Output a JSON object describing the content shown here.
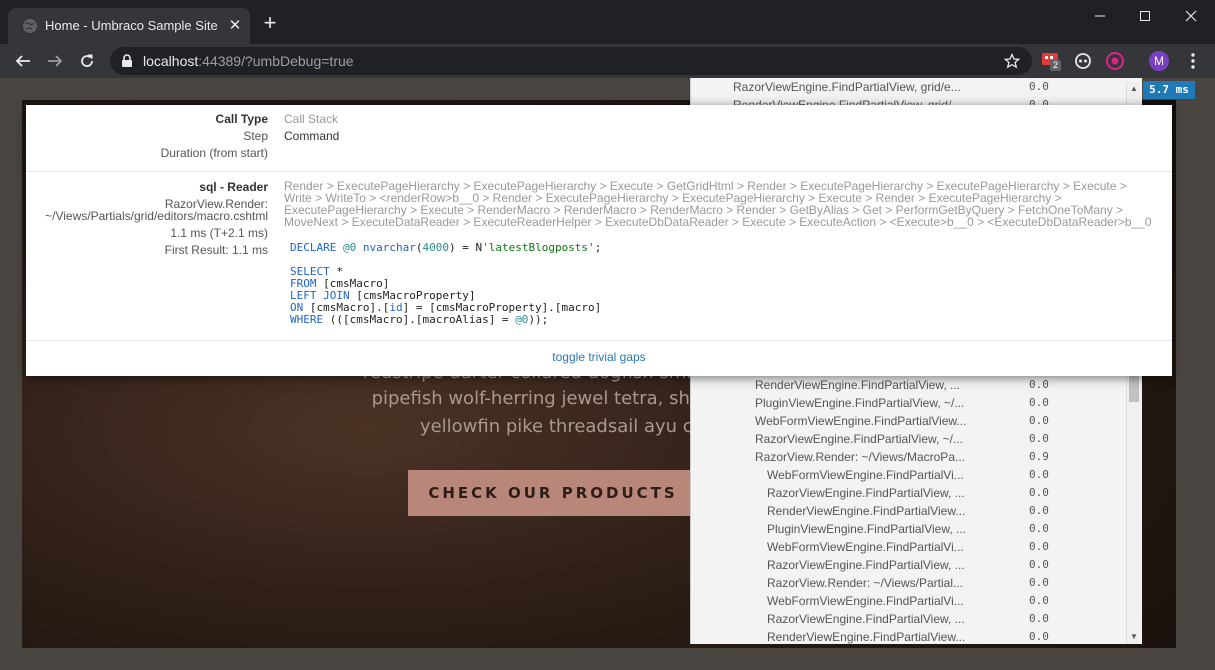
{
  "browser": {
    "tab_title": "Home - Umbraco Sample Site",
    "url_host": "localhost",
    "url_rest": ":44389/?umbDebug=true",
    "extension_badge": "2",
    "profile_initial": "M"
  },
  "hero": {
    "line1": "redstripe darter collared dogfish smalleye squaretail",
    "line2": "pipefish wolf-herring jewel tetra, shiner; gibberfish",
    "line3": "yellowfin pike threadsail ayu cutlassfish",
    "cta_label": "CHECK OUR PRODUCTS"
  },
  "profiler": {
    "total_badge": "5.7 ms",
    "rows": [
      {
        "name": "RazorViewEngine.FindPartialView, grid/e...",
        "dur": "0.0",
        "indent": 0
      },
      {
        "name": "RenderViewEngine.FindPartialView, grid/...",
        "dur": "0.0",
        "indent": 0
      },
      {
        "name": "RenderViewEngine.FindPartialView, ...",
        "dur": "0.0",
        "indent": 1
      },
      {
        "name": "PluginViewEngine.FindPartialView, ~/...",
        "dur": "0.0",
        "indent": 1
      },
      {
        "name": "WebFormViewEngine.FindPartialView...",
        "dur": "0.0",
        "indent": 1
      },
      {
        "name": "RazorViewEngine.FindPartialView, ~/...",
        "dur": "0.0",
        "indent": 1
      },
      {
        "name": "RazorView.Render: ~/Views/MacroPa...",
        "dur": "0.9",
        "indent": 1
      },
      {
        "name": "WebFormViewEngine.FindPartialVi...",
        "dur": "0.0",
        "indent": 2
      },
      {
        "name": "RazorViewEngine.FindPartialView, ...",
        "dur": "0.0",
        "indent": 2
      },
      {
        "name": "RenderViewEngine.FindPartialView...",
        "dur": "0.0",
        "indent": 2
      },
      {
        "name": "PluginViewEngine.FindPartialView, ...",
        "dur": "0.0",
        "indent": 2
      },
      {
        "name": "WebFormViewEngine.FindPartialVi...",
        "dur": "0.0",
        "indent": 2
      },
      {
        "name": "RazorViewEngine.FindPartialView, ...",
        "dur": "0.0",
        "indent": 2
      },
      {
        "name": "RazorView.Render: ~/Views/Partial...",
        "dur": "0.0",
        "indent": 2
      },
      {
        "name": "WebFormViewEngine.FindPartialVi...",
        "dur": "0.0",
        "indent": 2
      },
      {
        "name": "RazorViewEngine.FindPartialView, ...",
        "dur": "0.0",
        "indent": 2
      },
      {
        "name": "RenderViewEngine.FindPartialView...",
        "dur": "0.0",
        "indent": 2
      }
    ]
  },
  "popup": {
    "call_type_label": "Call Type",
    "call_type_value": "Call Stack",
    "step_label": "Step",
    "step_value": "Command",
    "duration_label": "Duration (from start)",
    "sql_type": "sql - Reader",
    "render_line1": "RazorView.Render:",
    "render_line2": "~/Views/Partials/grid/editors/macro.cshtml",
    "timing": "1.1 ms (T+2.1 ms)",
    "first_result": "First Result: 1.1 ms",
    "call_stack": "Render > ExecutePageHierarchy > ExecutePageHierarchy > Execute > GetGridHtml > Render > ExecutePageHierarchy > ExecutePageHierarchy > Execute > Write > WriteTo > <renderRow>b__0 > Render > ExecutePageHierarchy > ExecutePageHierarchy > Execute > Render > ExecutePageHierarchy > ExecutePageHierarchy > Execute > RenderMacro > RenderMacro > RenderMacro > Render > GetByAlias > Get > PerformGetByQuery > FetchOneToMany > MoveNext > ExecuteDataReader > ExecuteReaderHelper > ExecuteDbDataReader > Execute > ExecuteAction > <Execute>b__0 > <ExecuteDbDataReader>b__0",
    "toggle_label": "toggle trivial gaps"
  }
}
